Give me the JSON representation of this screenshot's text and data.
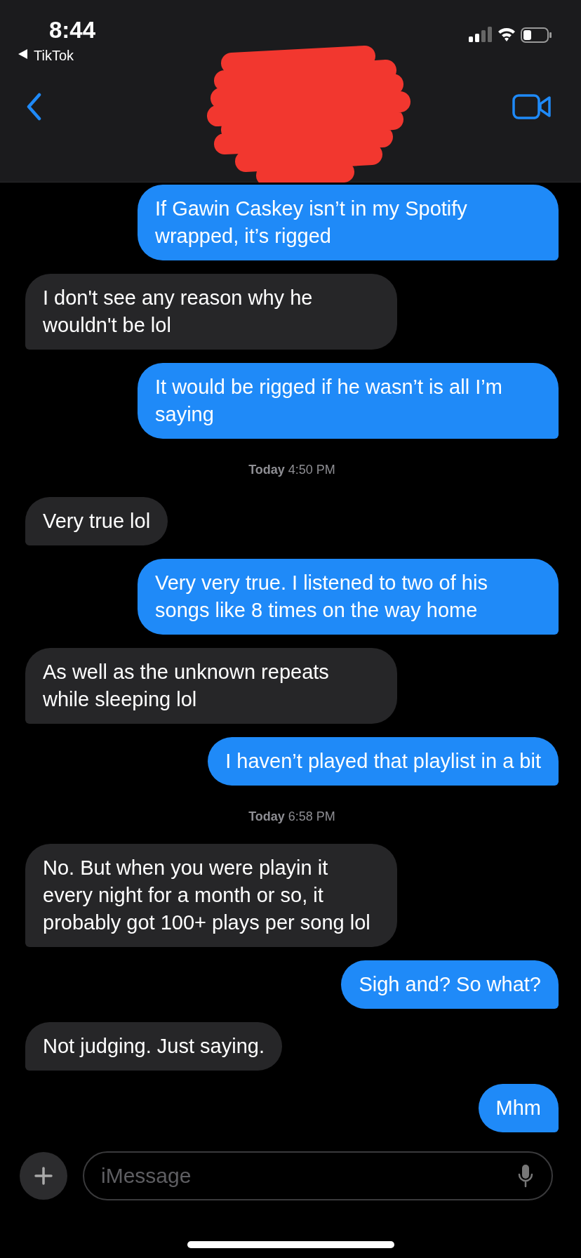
{
  "status_bar": {
    "time": "8:44",
    "back_app": "TikTok"
  },
  "messages": [
    {
      "kind": "sent",
      "text": "If Gawin Caskey isn’t in my Spotify wrapped, it’s rigged"
    },
    {
      "kind": "received",
      "text": "I don't see any reason why he wouldn't be lol"
    },
    {
      "kind": "sent",
      "text": "It would be rigged if he wasn’t is all I’m saying"
    },
    {
      "kind": "timestamp",
      "text": "**Today** 4:50 PM"
    },
    {
      "kind": "received",
      "text": "Very true lol"
    },
    {
      "kind": "sent",
      "text": "Very very true. I listened to two of his songs like 8 times on the way home"
    },
    {
      "kind": "received",
      "text": "As well as the unknown repeats while sleeping lol"
    },
    {
      "kind": "sent",
      "text": "I haven’t played that playlist in a bit"
    },
    {
      "kind": "timestamp",
      "text": "**Today** 6:58 PM"
    },
    {
      "kind": "received",
      "text": "No. But when you were playin it every night for a month or so, it probably got 100+ plays per song lol"
    },
    {
      "kind": "sent",
      "text": "Sigh and? So what?"
    },
    {
      "kind": "received",
      "text": "Not judging. Just saying."
    },
    {
      "kind": "sent",
      "text": "Mhm"
    }
  ],
  "composer": {
    "placeholder": "iMessage"
  }
}
